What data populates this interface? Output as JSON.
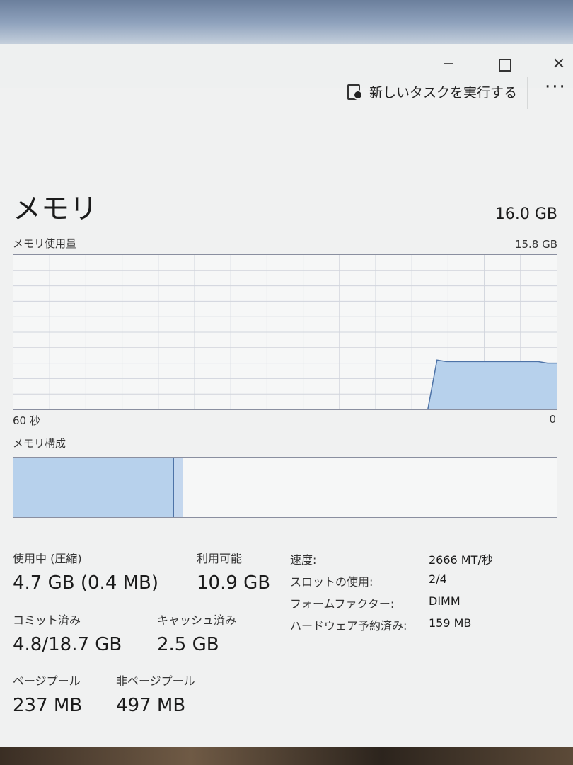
{
  "window_controls": {
    "minimize": "−",
    "close": "✕"
  },
  "toolbar": {
    "run_new_task": "新しいタスクを実行する",
    "more": "···"
  },
  "memory": {
    "title": "メモリ",
    "total": "16.0 GB",
    "usage_label": "メモリ使用量",
    "usage_max": "15.8 GB",
    "time_left": "60 秒",
    "time_right": "0",
    "composition_label": "メモリ構成",
    "usage_history_fraction": [
      0,
      0,
      0,
      0,
      0,
      0,
      0,
      0,
      0,
      0,
      0,
      0,
      0,
      0,
      0,
      0,
      0,
      0,
      0,
      0,
      0,
      0,
      0,
      0,
      0,
      0,
      0,
      0,
      0,
      0,
      0,
      0,
      0,
      0,
      0,
      0,
      0,
      0,
      0,
      0,
      0,
      0,
      0,
      0,
      0,
      0,
      0.32,
      0.31,
      0.31,
      0.31,
      0.31,
      0.31,
      0.31,
      0.31,
      0.31,
      0.31,
      0.31,
      0.31,
      0.3,
      0.3
    ],
    "composition_fraction": {
      "in_use": 0.295,
      "modified": 0.018,
      "standby": 0.142
    }
  },
  "stats": {
    "in_use": {
      "label": "使用中 (圧縮)",
      "value": "4.7 GB (0.4 MB)"
    },
    "available": {
      "label": "利用可能",
      "value": "10.9 GB"
    },
    "committed": {
      "label": "コミット済み",
      "value": "4.8/18.7 GB"
    },
    "cached": {
      "label": "キャッシュ済み",
      "value": "2.5 GB"
    },
    "paged_pool": {
      "label": "ページプール",
      "value": "237 MB"
    },
    "non_paged_pool": {
      "label": "非ページプール",
      "value": "497 MB"
    }
  },
  "details": {
    "speed": {
      "label": "速度:",
      "value": "2666 MT/秒"
    },
    "slots": {
      "label": "スロットの使用:",
      "value": "2/4"
    },
    "form_factor": {
      "label": "フォームファクター:",
      "value": "DIMM"
    },
    "hw_reserved": {
      "label": "ハードウェア予約済み:",
      "value": "159 MB"
    }
  },
  "colors": {
    "graph_fill": "#b7d1ec",
    "graph_line": "#4e73a7",
    "grid": "#d0d4dc",
    "border": "#8a8fa0"
  }
}
